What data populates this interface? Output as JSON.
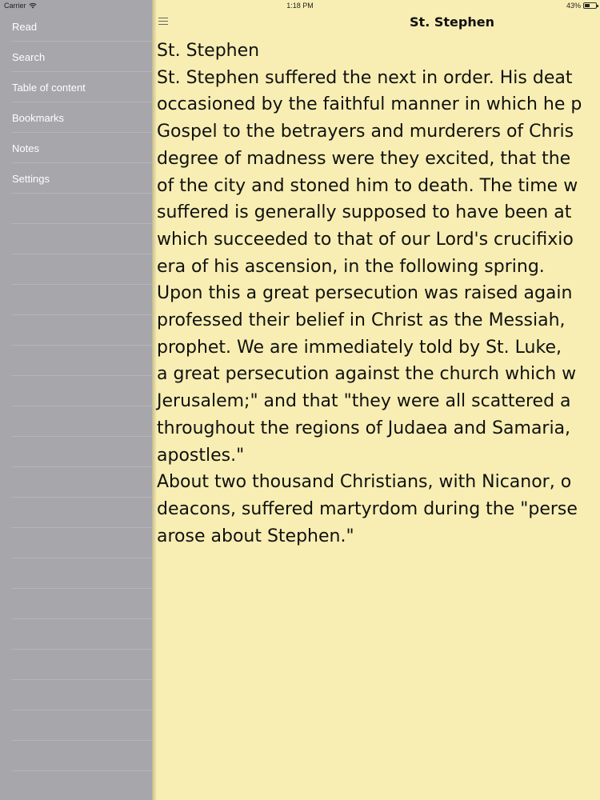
{
  "status_bar": {
    "carrier": "Carrier",
    "time": "1:18 PM",
    "battery_percent": "43%",
    "battery_level": 0.43
  },
  "sidebar": {
    "items": [
      {
        "label": "Read"
      },
      {
        "label": "Search"
      },
      {
        "label": "Table of content"
      },
      {
        "label": "Bookmarks"
      },
      {
        "label": "Notes"
      },
      {
        "label": "Settings"
      }
    ]
  },
  "header": {
    "title": "St. Stephen",
    "menu_icon": "hamburger-menu-icon"
  },
  "article": {
    "lines": [
      "St. Stephen",
      "St. Stephen suffered the next in order. His deat",
      "occasioned by the faithful manner in which he p",
      "Gospel to the betrayers and murderers of Chris",
      "degree of madness were they excited, that the",
      "of the city and stoned him to death. The time w",
      "suffered is generally supposed to have been at",
      "which succeeded to that of our Lord's crucifixio",
      "era of his ascension, in the following spring.",
      "Upon this a great persecution was raised again",
      "professed their belief in Christ as the Messiah,",
      "prophet. We are immediately told by St. Luke,",
      "a great persecution against the church which w",
      "Jerusalem;\" and that \"they were all scattered a",
      "throughout the regions of Judaea and Samaria,",
      "apostles.\"",
      "About two thousand Christians, with Nicanor, o",
      "deacons, suffered martyrdom during the \"perse",
      "arose about Stephen.\""
    ]
  },
  "colors": {
    "sidebar_bg": "#a6a6ab",
    "page_bg": "#f8eeb3",
    "text": "#111111"
  }
}
